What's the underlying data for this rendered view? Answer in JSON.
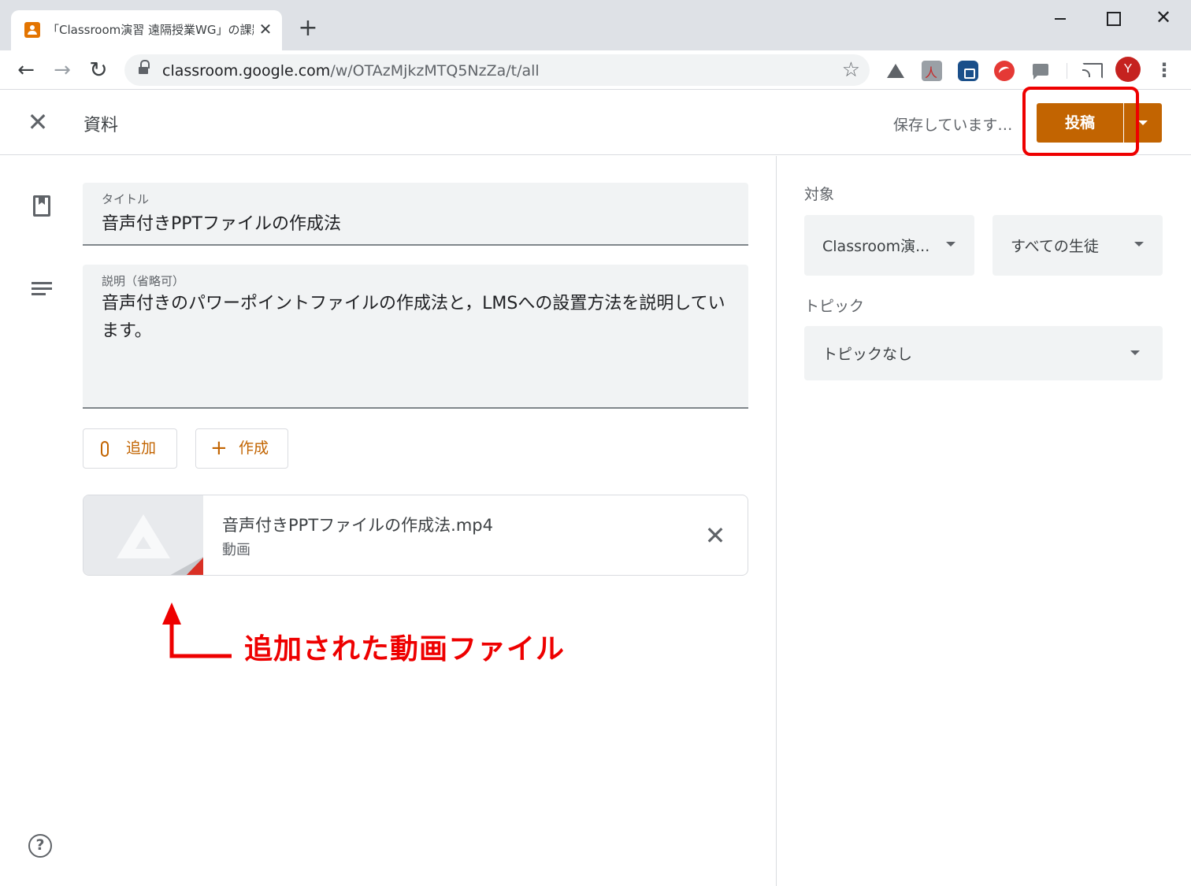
{
  "browser": {
    "tab_title": "「Classroom演習 遠隔授業WG」の課題",
    "tab_close": "✕",
    "new_tab": "+",
    "url_host": "classroom.google.com",
    "url_path": "/w/OTAzMjkzMTQ5NzZa/t/all",
    "avatar_letter": "Y",
    "window_close": "✕",
    "icons": [
      "back-icon",
      "forward-icon",
      "reload-icon",
      "lock-icon",
      "star-icon",
      "drive-extension-icon",
      "pdf-extension-icon",
      "lock-extension-icon",
      "trend-extension-icon",
      "chat-extension-icon",
      "cast-icon",
      "menu-icon"
    ]
  },
  "header": {
    "title": "資料",
    "status": "保存しています…",
    "post_label": "投稿",
    "highlight_color": "#ee0000",
    "accent_color": "#c26401"
  },
  "form": {
    "title_label": "タイトル",
    "title_value": "音声付きPPTファイルの作成法",
    "desc_label": "説明（省略可）",
    "desc_value": "音声付きのパワーポイントファイルの作成法と，LMSへの設置方法を説明しています。",
    "add_label": "追加",
    "create_label": "作成"
  },
  "attachment": {
    "name": "音声付きPPTファイルの作成法.mp4",
    "type": "動画",
    "remove": "✕"
  },
  "annotation": {
    "text": "追加された動画ファイル"
  },
  "sidebar": {
    "target_label": "対象",
    "class_value": "Classroom演...",
    "students_value": "すべての生徒",
    "topic_label": "トピック",
    "topic_value": "トピックなし"
  },
  "help": "?"
}
